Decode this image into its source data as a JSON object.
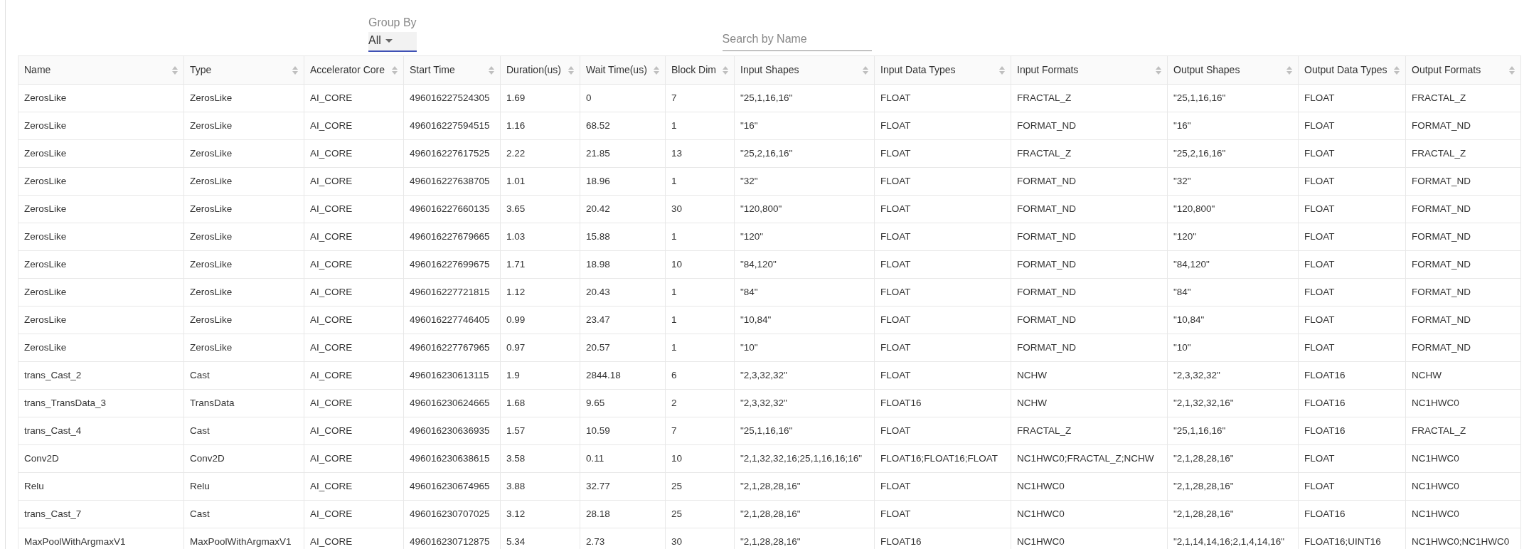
{
  "group_by": {
    "label": "Group By",
    "value": "All"
  },
  "search": {
    "placeholder": "Search by Name"
  },
  "table": {
    "columns": [
      "Name",
      "Type",
      "Accelerator Core",
      "Start Time",
      "Duration(us)",
      "Wait Time(us)",
      "Block Dim",
      "Input Shapes",
      "Input Data Types",
      "Input Formats",
      "Output Shapes",
      "Output Data Types",
      "Output Formats"
    ],
    "rows": [
      [
        "ZerosLike",
        "ZerosLike",
        "AI_CORE",
        "496016227524305",
        "1.69",
        "0",
        "7",
        "\"25,1,16,16\"",
        "FLOAT",
        "FRACTAL_Z",
        "\"25,1,16,16\"",
        "FLOAT",
        "FRACTAL_Z"
      ],
      [
        "ZerosLike",
        "ZerosLike",
        "AI_CORE",
        "496016227594515",
        "1.16",
        "68.52",
        "1",
        "\"16\"",
        "FLOAT",
        "FORMAT_ND",
        "\"16\"",
        "FLOAT",
        "FORMAT_ND"
      ],
      [
        "ZerosLike",
        "ZerosLike",
        "AI_CORE",
        "496016227617525",
        "2.22",
        "21.85",
        "13",
        "\"25,2,16,16\"",
        "FLOAT",
        "FRACTAL_Z",
        "\"25,2,16,16\"",
        "FLOAT",
        "FRACTAL_Z"
      ],
      [
        "ZerosLike",
        "ZerosLike",
        "AI_CORE",
        "496016227638705",
        "1.01",
        "18.96",
        "1",
        "\"32\"",
        "FLOAT",
        "FORMAT_ND",
        "\"32\"",
        "FLOAT",
        "FORMAT_ND"
      ],
      [
        "ZerosLike",
        "ZerosLike",
        "AI_CORE",
        "496016227660135",
        "3.65",
        "20.42",
        "30",
        "\"120,800\"",
        "FLOAT",
        "FORMAT_ND",
        "\"120,800\"",
        "FLOAT",
        "FORMAT_ND"
      ],
      [
        "ZerosLike",
        "ZerosLike",
        "AI_CORE",
        "496016227679665",
        "1.03",
        "15.88",
        "1",
        "\"120\"",
        "FLOAT",
        "FORMAT_ND",
        "\"120\"",
        "FLOAT",
        "FORMAT_ND"
      ],
      [
        "ZerosLike",
        "ZerosLike",
        "AI_CORE",
        "496016227699675",
        "1.71",
        "18.98",
        "10",
        "\"84,120\"",
        "FLOAT",
        "FORMAT_ND",
        "\"84,120\"",
        "FLOAT",
        "FORMAT_ND"
      ],
      [
        "ZerosLike",
        "ZerosLike",
        "AI_CORE",
        "496016227721815",
        "1.12",
        "20.43",
        "1",
        "\"84\"",
        "FLOAT",
        "FORMAT_ND",
        "\"84\"",
        "FLOAT",
        "FORMAT_ND"
      ],
      [
        "ZerosLike",
        "ZerosLike",
        "AI_CORE",
        "496016227746405",
        "0.99",
        "23.47",
        "1",
        "\"10,84\"",
        "FLOAT",
        "FORMAT_ND",
        "\"10,84\"",
        "FLOAT",
        "FORMAT_ND"
      ],
      [
        "ZerosLike",
        "ZerosLike",
        "AI_CORE",
        "496016227767965",
        "0.97",
        "20.57",
        "1",
        "\"10\"",
        "FLOAT",
        "FORMAT_ND",
        "\"10\"",
        "FLOAT",
        "FORMAT_ND"
      ],
      [
        "trans_Cast_2",
        "Cast",
        "AI_CORE",
        "496016230613115",
        "1.9",
        "2844.18",
        "6",
        "\"2,3,32,32\"",
        "FLOAT",
        "NCHW",
        "\"2,3,32,32\"",
        "FLOAT16",
        "NCHW"
      ],
      [
        "trans_TransData_3",
        "TransData",
        "AI_CORE",
        "496016230624665",
        "1.68",
        "9.65",
        "2",
        "\"2,3,32,32\"",
        "FLOAT16",
        "NCHW",
        "\"2,1,32,32,16\"",
        "FLOAT16",
        "NC1HWC0"
      ],
      [
        "trans_Cast_4",
        "Cast",
        "AI_CORE",
        "496016230636935",
        "1.57",
        "10.59",
        "7",
        "\"25,1,16,16\"",
        "FLOAT",
        "FRACTAL_Z",
        "\"25,1,16,16\"",
        "FLOAT16",
        "FRACTAL_Z"
      ],
      [
        "Conv2D",
        "Conv2D",
        "AI_CORE",
        "496016230638615",
        "3.58",
        "0.11",
        "10",
        "\"2,1,32,32,16;25,1,16,16;16\"",
        "FLOAT16;FLOAT16;FLOAT",
        "NC1HWC0;FRACTAL_Z;NCHW",
        "\"2,1,28,28,16\"",
        "FLOAT",
        "NC1HWC0"
      ],
      [
        "Relu",
        "Relu",
        "AI_CORE",
        "496016230674965",
        "3.88",
        "32.77",
        "25",
        "\"2,1,28,28,16\"",
        "FLOAT",
        "NC1HWC0",
        "\"2,1,28,28,16\"",
        "FLOAT",
        "NC1HWC0"
      ],
      [
        "trans_Cast_7",
        "Cast",
        "AI_CORE",
        "496016230707025",
        "3.12",
        "28.18",
        "25",
        "\"2,1,28,28,16\"",
        "FLOAT",
        "NC1HWC0",
        "\"2,1,28,28,16\"",
        "FLOAT16",
        "NC1HWC0"
      ],
      [
        "MaxPoolWithArgmaxV1",
        "MaxPoolWithArgmaxV1",
        "AI_CORE",
        "496016230712875",
        "5.34",
        "2.73",
        "30",
        "\"2,1,28,28,16\"",
        "FLOAT16",
        "NC1HWC0",
        "\"2,1,14,14,16;2,1,4,14,16\"",
        "FLOAT16;UINT16",
        "NC1HWC0;NC1HWC0"
      ]
    ]
  }
}
